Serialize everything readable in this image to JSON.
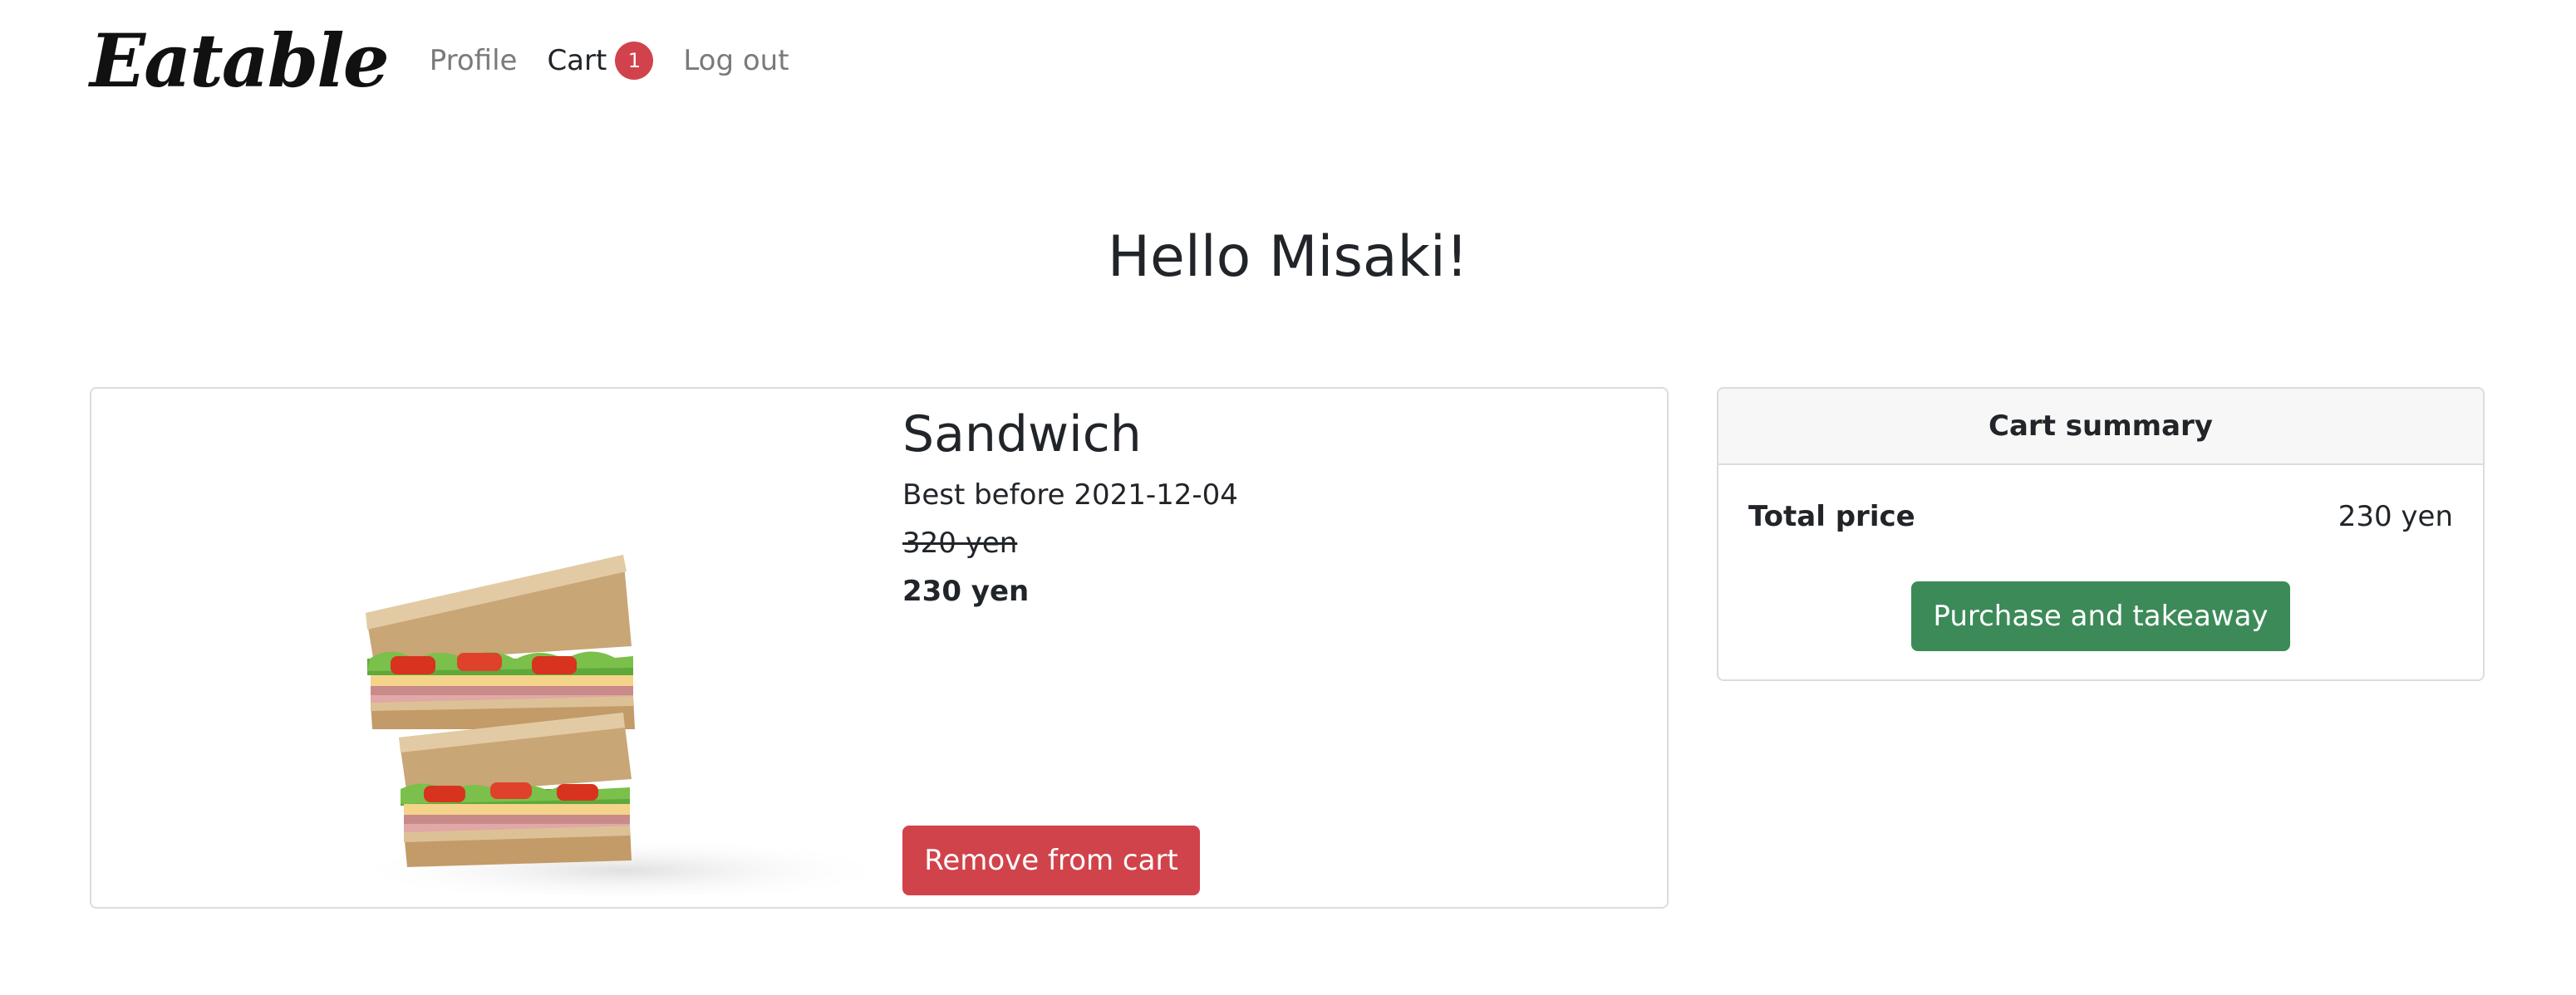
{
  "navbar": {
    "brand": "Eatable",
    "links": {
      "profile": "Profile",
      "cart": "Cart",
      "cart_count": "1",
      "logout": "Log out"
    }
  },
  "greeting": "Hello Misaki!",
  "cart_item": {
    "name": "Sandwich",
    "best_before": "Best before 2021-12-04",
    "original_price": "320 yen",
    "discount_price": "230 yen",
    "image": "sandwich-image",
    "remove_label": "Remove from cart"
  },
  "summary": {
    "title": "Cart summary",
    "total_label": "Total price",
    "total_value": "230 yen",
    "purchase_label": "Purchase and takeaway"
  },
  "colors": {
    "danger": "#d1434b",
    "success": "#3c8a58",
    "badge": "#d2424c"
  }
}
